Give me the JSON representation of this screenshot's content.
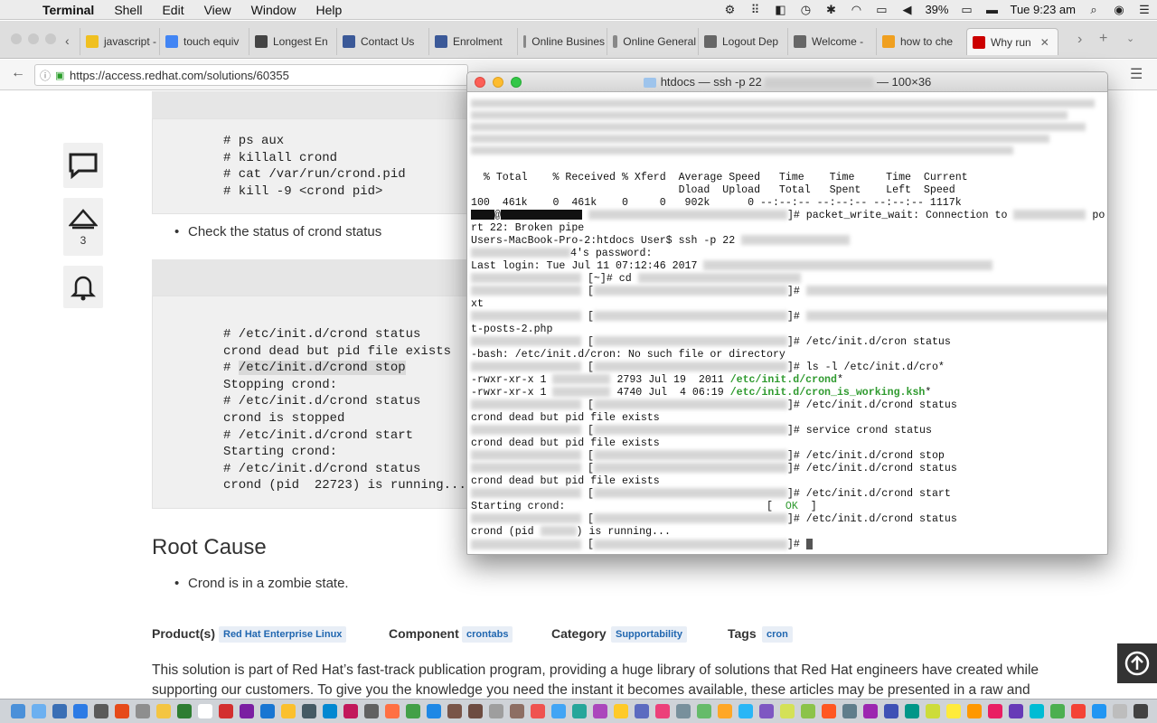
{
  "menubar": {
    "app_name": "Terminal",
    "items": [
      "Shell",
      "Edit",
      "View",
      "Window",
      "Help"
    ],
    "battery": "39%",
    "clock": "Tue 9:23 am"
  },
  "tabs": [
    {
      "label": "javascript -",
      "color": "#f0c020"
    },
    {
      "label": "touch equiv",
      "color": "#4285f4"
    },
    {
      "label": "Longest En",
      "color": "#444444"
    },
    {
      "label": "Contact Us",
      "color": "#3b5998"
    },
    {
      "label": "Enrolment",
      "color": "#3b5998"
    },
    {
      "label": "Online Busines",
      "color": "#888888"
    },
    {
      "label": "Online General",
      "color": "#888888"
    },
    {
      "label": "Logout Dep",
      "color": "#666666"
    },
    {
      "label": "Welcome -",
      "color": "#666666"
    },
    {
      "label": "how to che",
      "color": "#f0a020"
    },
    {
      "label": "Why run",
      "color": "#cc0000"
    }
  ],
  "url": "https://access.redhat.com/solutions/60355",
  "sidebar": {
    "like_count": "3"
  },
  "code_block_1": [
    "# ps aux",
    "# killall crond",
    "# cat /var/run/crond.pid",
    "# kill -9 <crond pid>"
  ],
  "bullet_check_status": "Check the status of crond status",
  "code_block_2": [
    "# /etc/init.d/crond status",
    "crond dead but pid file exists",
    "# ",
    "Stopping crond:",
    "# /etc/init.d/crond status",
    "crond is stopped",
    "# /etc/init.d/crond start",
    "Starting crond:",
    "# /etc/init.d/crond status",
    "crond (pid  22723) is running..."
  ],
  "code_block_2_highlight": "/etc/init.d/crond stop",
  "root_cause_heading": "Root Cause",
  "root_cause_bullet": "Crond is in a zombie state.",
  "meta": {
    "product_label": "Product(s)",
    "product_value": "Red Hat Enterprise Linux",
    "component_label": "Component",
    "component_value": "crontabs",
    "category_label": "Category",
    "category_value": "Supportability",
    "tags_label": "Tags",
    "tags_value": "cron"
  },
  "body_text": "This solution is part of Red Hat’s fast-track publication program, providing a huge library of solutions that Red Hat engineers have created while supporting our customers. To give you the knowledge you need the instant it becomes available, these articles may be presented in a raw and",
  "terminal": {
    "title_left": "htdocs — ssh -p 22",
    "title_right": "— 100×36",
    "lines": {
      "curl_header_1": "  % Total    % Received % Xferd  Average Speed   Time    Time     Time  Current",
      "curl_header_2": "                                 Dload  Upload   Total   Spent    Left  Speed",
      "curl_progress": "100  461k    0  461k    0     0   902k      0 --:--:-- --:--:-- --:--:-- 1117k",
      "pkt_a": "]# packet_write_wait: Connection to",
      "pkt_b": "po",
      "pkt_c": "rt 22: Broken pipe",
      "ssh_cmd": "Users-MacBook-Pro-2:htdocs User$ ssh -p 22",
      "password": "4's password:",
      "last_login": "Last login: Tue Jul 11 07:12:46 2017",
      "cd": "[~]# cd",
      "xt": "xt",
      "posts": "t-posts-2.php",
      "cron_status_cmd": "# /etc/init.d/cron status",
      "no_such_file": "-bash: /etc/init.d/cron: No such file or directory",
      "ls_cmd": "# ls -l /etc/init.d/cro*",
      "ls_row_1_meta": "-rwxr-xr-x 1",
      "ls_row_1_info": "2793 Jul 19  2011",
      "ls_row_1_file": "/etc/init.d/crond",
      "ls_row_2_meta": "-rwxr-xr-x 1",
      "ls_row_2_info": "4740 Jul  4 06:19",
      "ls_row_2_file": "/etc/init.d/cron_is_working.ksh",
      "crond_status_cmd": "# /etc/init.d/crond status",
      "dead_pid": "crond dead but pid file exists",
      "service_cmd": "# service crond status",
      "stop_cmd": "# /etc/init.d/crond stop",
      "start_cmd": "# /etc/init.d/crond start",
      "starting": "Starting crond:",
      "ok": "OK",
      "running_a": "crond (pid",
      "running_b": ") is running...",
      "prompt": "#"
    }
  },
  "dock_colors": [
    "#4a90d9",
    "#6cb0f0",
    "#3a6fb5",
    "#2c7be5",
    "#5a5a5a",
    "#e64a19",
    "#8e8e8e",
    "#f4c542",
    "#2e7d32",
    "#ffffff",
    "#d32f2f",
    "#7b1fa2",
    "#1976d2",
    "#fbc02d",
    "#455a64",
    "#0288d1",
    "#c2185b",
    "#616161",
    "#ff7043",
    "#43a047",
    "#1e88e5",
    "#795548",
    "#6d4c41",
    "#9e9e9e",
    "#8d6e63",
    "#ef5350",
    "#42a5f5",
    "#26a69a",
    "#ab47bc",
    "#ffca28",
    "#5c6bc0",
    "#ec407a",
    "#78909c",
    "#66bb6a",
    "#ffa726",
    "#29b6f6",
    "#7e57c2",
    "#d4e157",
    "#8bc34a",
    "#ff5722",
    "#607d8b",
    "#9c27b0",
    "#3f51b5",
    "#009688",
    "#cddc39",
    "#ffeb3b",
    "#ff9800",
    "#e91e63",
    "#673ab7",
    "#00bcd4",
    "#4caf50",
    "#f44336",
    "#2196f3",
    "#bdbdbd",
    "#424242"
  ]
}
